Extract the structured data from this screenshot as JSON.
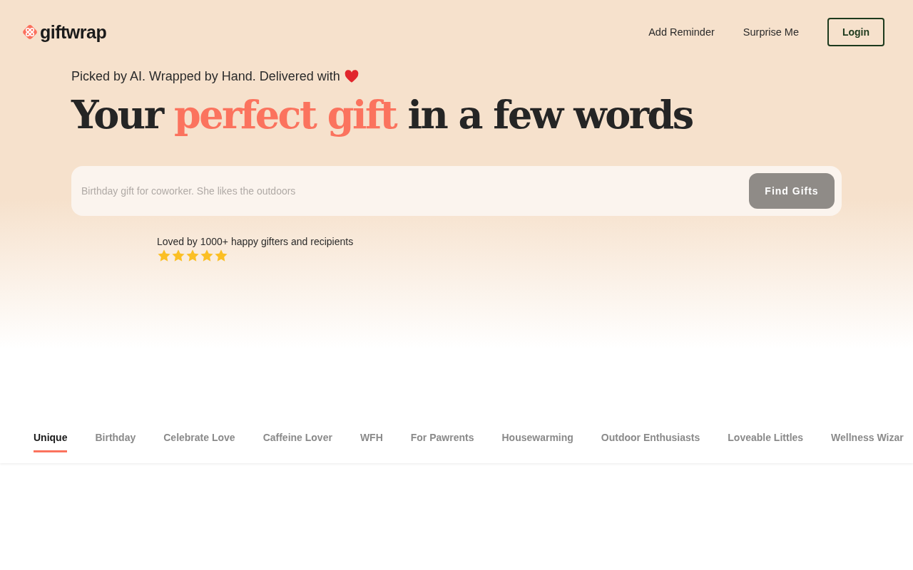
{
  "header": {
    "logo": "giftwrap",
    "nav": [
      "Add Reminder",
      "Surprise Me"
    ],
    "login": "Login"
  },
  "hero": {
    "tagline": "Picked by AI. Wrapped by Hand. Delivered with",
    "headline": [
      {
        "text": "Your ",
        "accent": false
      },
      {
        "text": "perfect gift",
        "accent": true
      },
      {
        "text": " in a few words",
        "accent": false
      }
    ],
    "search": {
      "placeholder": "Birthday gift for coworker. She likes the outdoors",
      "button": "Find Gifts"
    },
    "rating": {
      "text": "Loved by 1000+ happy gifters and recipients",
      "stars": 5
    }
  },
  "tabs": [
    {
      "label": "Unique",
      "selected": true
    },
    {
      "label": "Birthday",
      "selected": false
    },
    {
      "label": "Celebrate Love",
      "selected": false
    },
    {
      "label": "Caffeine Lover",
      "selected": false
    },
    {
      "label": "WFH",
      "selected": false
    },
    {
      "label": "For Pawrents",
      "selected": false
    },
    {
      "label": "Housewarming",
      "selected": false
    },
    {
      "label": "Outdoor Enthusiasts",
      "selected": false
    },
    {
      "label": "Loveable Littles",
      "selected": false
    },
    {
      "label": "Wellness Wizar",
      "selected": false
    }
  ]
}
